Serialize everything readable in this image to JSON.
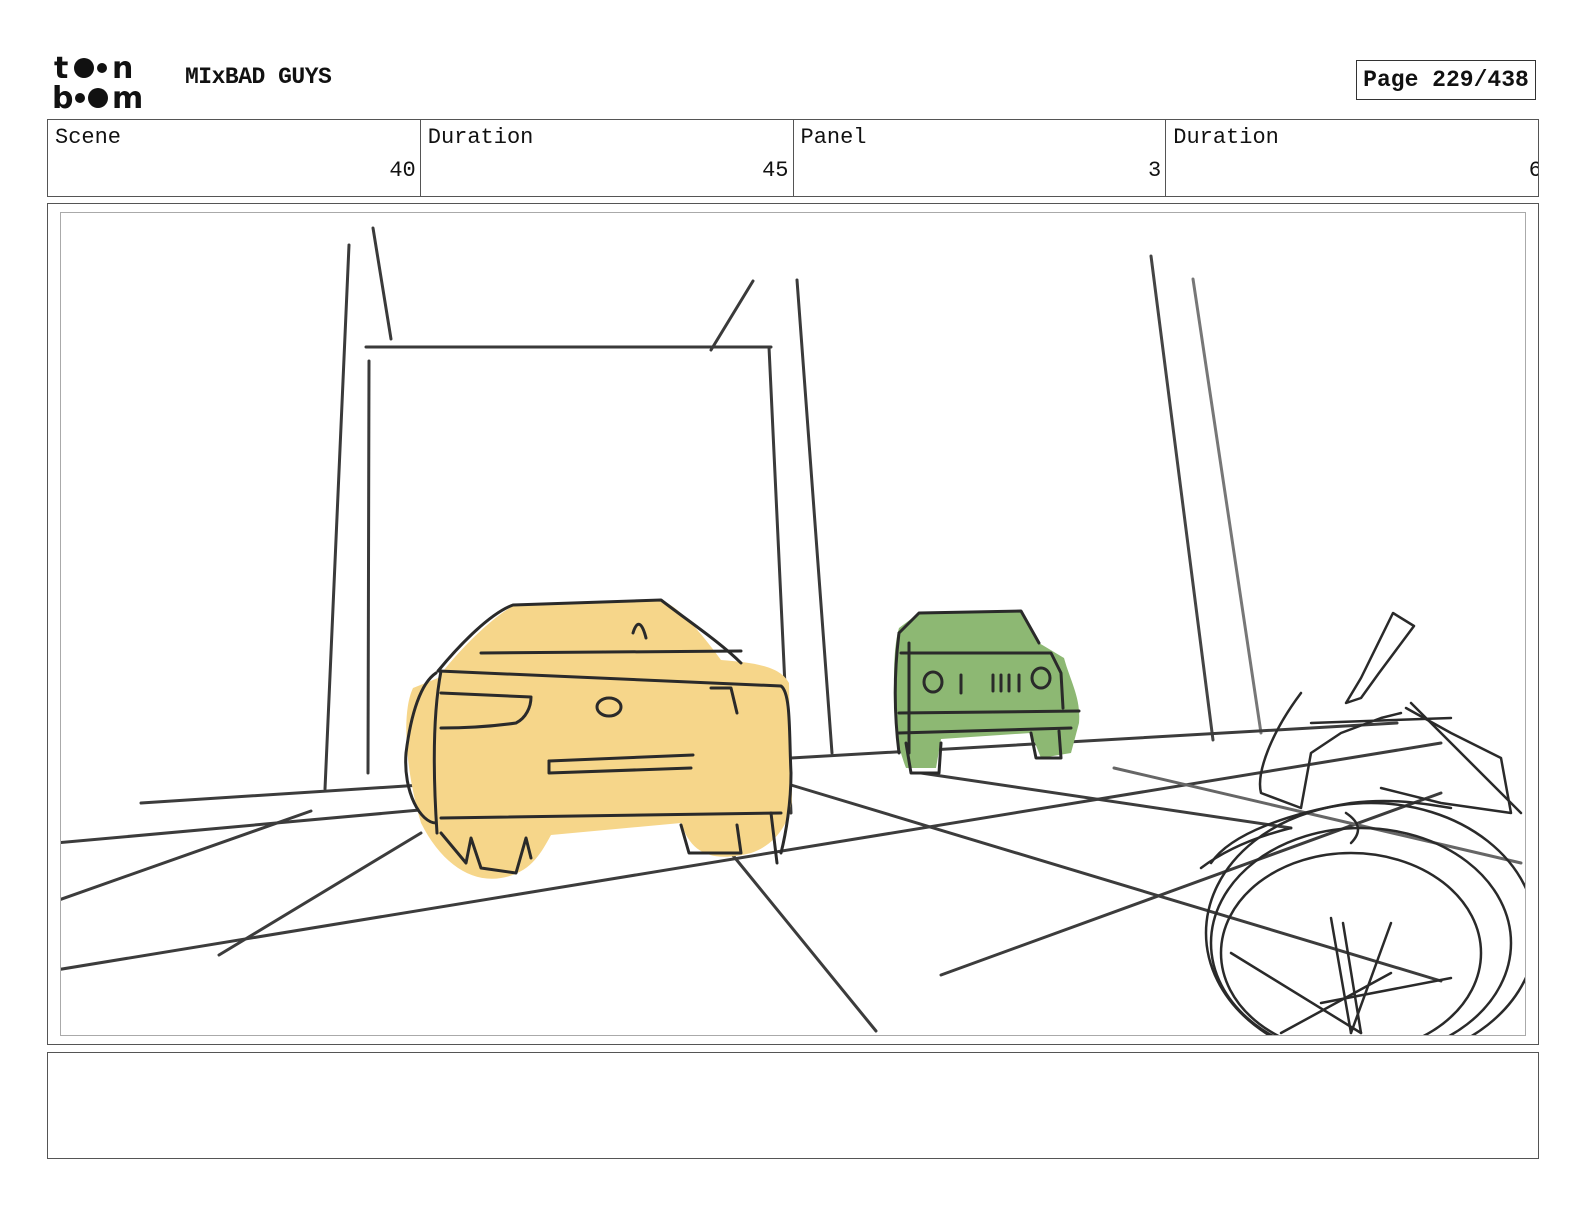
{
  "header": {
    "logo_name": "toon-boom-logo",
    "project_title": "MIxBAD GUYS",
    "page_indicator": "Page 229/438"
  },
  "info_fields": [
    {
      "label": "Scene",
      "value": "40"
    },
    {
      "label": "Duration",
      "value": "45"
    },
    {
      "label": "Panel",
      "value": "3"
    },
    {
      "label": "Duration",
      "value": "6"
    }
  ],
  "sketch": {
    "description_icons": [
      "yellow-car-sketch",
      "green-jeep-sketch",
      "motorcycle-sketch"
    ],
    "colors": {
      "yellow_car": "#f6d68a",
      "green_jeep": "#8db873",
      "line": "#2a2a2a"
    }
  },
  "notes": {
    "text": ""
  }
}
